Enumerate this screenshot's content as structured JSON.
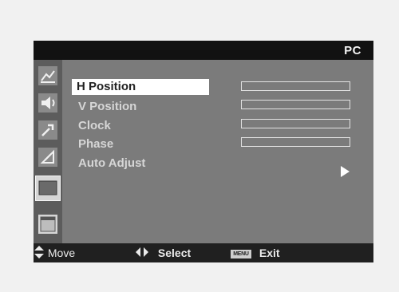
{
  "header": {
    "source_label": "PC"
  },
  "sidebar": {
    "icons": [
      {
        "name": "picture-icon"
      },
      {
        "name": "sound-icon"
      },
      {
        "name": "setup-icon"
      },
      {
        "name": "input-icon"
      },
      {
        "name": "pc-screen-icon",
        "selected": true
      },
      {
        "name": "option-icon"
      }
    ]
  },
  "menu": {
    "items": [
      {
        "label": "H Position",
        "highlighted": true
      },
      {
        "label": "V Position"
      },
      {
        "label": "Clock"
      },
      {
        "label": "Phase"
      },
      {
        "label": "Auto Adjust"
      }
    ]
  },
  "footer": {
    "move_label": "Move",
    "select_label": "Select",
    "menu_key_label": "MENU",
    "exit_label": "Exit"
  },
  "colors": {
    "panel": "#7b7b7b",
    "topbar": "#121212",
    "sidebar": "#5c5c5c",
    "highlight": "#ffffff",
    "text": "#d6d6d6"
  }
}
